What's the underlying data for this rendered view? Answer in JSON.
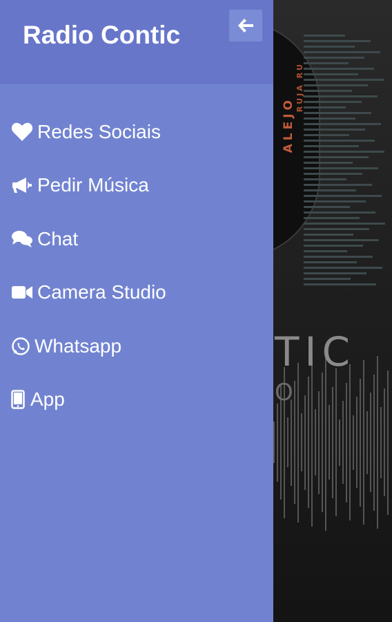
{
  "drawer": {
    "title": "Radio Contic",
    "back_icon": "arrow-left-icon"
  },
  "menu": {
    "items": [
      {
        "label": "Redes Sociais",
        "icon": "heart-icon"
      },
      {
        "label": "Pedir Música",
        "icon": "megaphone-icon"
      },
      {
        "label": "Chat",
        "icon": "chat-bubbles-icon"
      },
      {
        "label": "Camera Studio",
        "icon": "video-camera-icon"
      },
      {
        "label": "Whatsapp",
        "icon": "whatsapp-icon"
      },
      {
        "label": "App",
        "icon": "mobile-phone-icon"
      }
    ]
  },
  "background": {
    "logo_text": "ALEJO",
    "logo_text_small": "RUJA RU",
    "brand_text": "TIC",
    "brand_sub": "O"
  },
  "colors": {
    "drawer": "#7183d0",
    "drawer_header": "#6876c9",
    "text": "#ffffff"
  }
}
